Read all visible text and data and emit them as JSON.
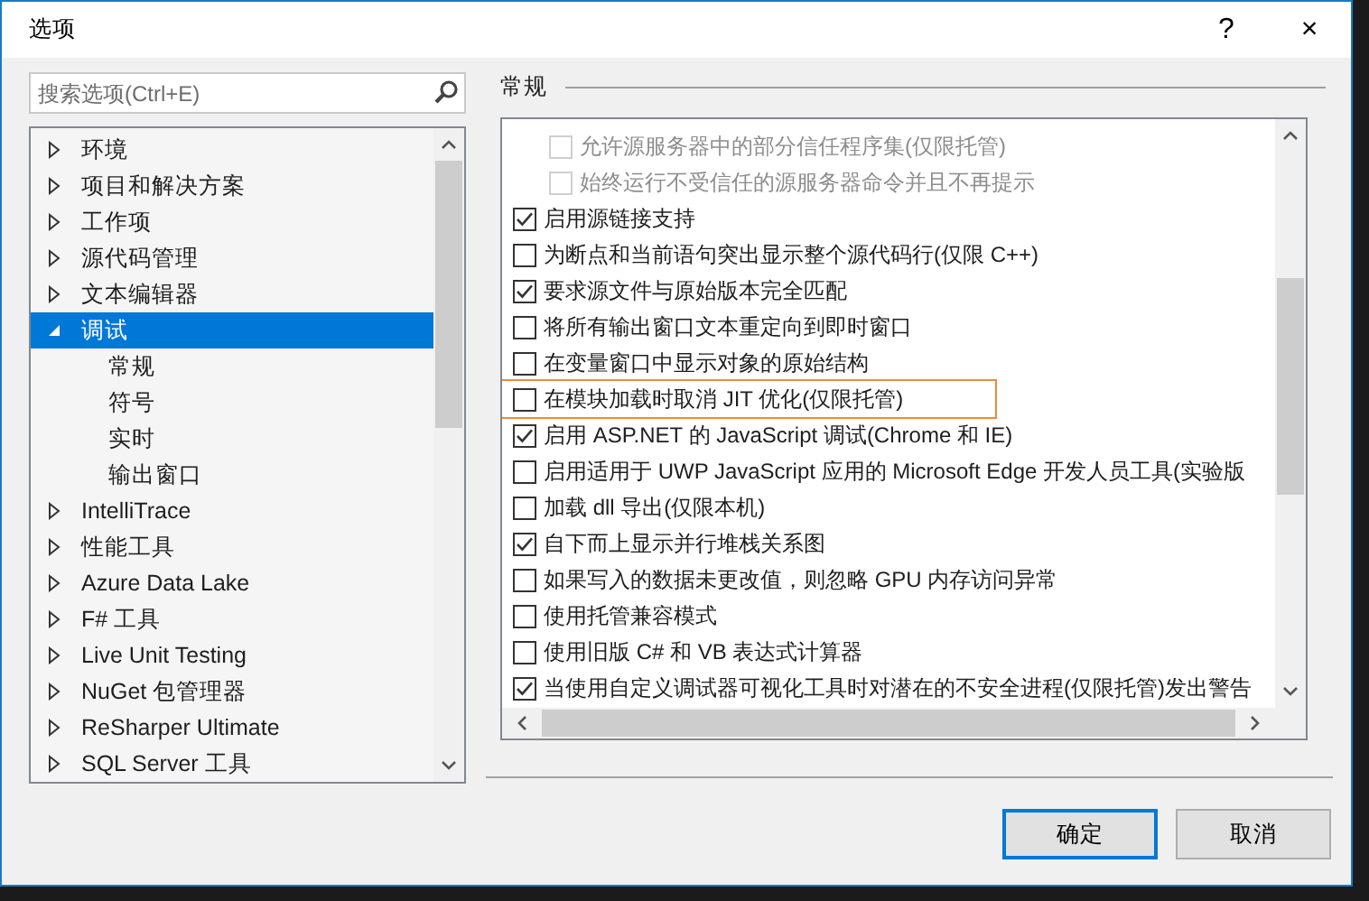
{
  "window": {
    "title": "选项",
    "help": "?",
    "close": "×"
  },
  "search": {
    "placeholder": "搜索选项(Ctrl+E)"
  },
  "tree": [
    {
      "label": "环境",
      "expanded": false,
      "selected": false
    },
    {
      "label": "项目和解决方案",
      "expanded": false,
      "selected": false
    },
    {
      "label": "工作项",
      "expanded": false,
      "selected": false
    },
    {
      "label": "源代码管理",
      "expanded": false,
      "selected": false
    },
    {
      "label": "文本编辑器",
      "expanded": false,
      "selected": false
    },
    {
      "label": "调试",
      "expanded": true,
      "selected": true,
      "children": [
        {
          "label": "常规",
          "selected": false
        },
        {
          "label": "符号",
          "selected": false
        },
        {
          "label": "实时",
          "selected": false
        },
        {
          "label": "输出窗口",
          "selected": false
        }
      ]
    },
    {
      "label": "IntelliTrace",
      "expanded": false,
      "selected": false
    },
    {
      "label": "性能工具",
      "expanded": false,
      "selected": false
    },
    {
      "label": "Azure Data Lake",
      "expanded": false,
      "selected": false
    },
    {
      "label": "F# 工具",
      "expanded": false,
      "selected": false
    },
    {
      "label": "Live Unit Testing",
      "expanded": false,
      "selected": false
    },
    {
      "label": "NuGet 包管理器",
      "expanded": false,
      "selected": false
    },
    {
      "label": "ReSharper Ultimate",
      "expanded": false,
      "selected": false
    },
    {
      "label": "SQL Server 工具",
      "expanded": false,
      "selected": false
    }
  ],
  "section_title": "常规",
  "options": [
    {
      "kind": "sub",
      "label": "允许源服务器中的部分信任程序集(仅限托管)",
      "checked": false,
      "disabled": true,
      "highlighted": false
    },
    {
      "kind": "sub",
      "label": "始终运行不受信任的源服务器命令并且不再提示",
      "checked": false,
      "disabled": true,
      "highlighted": false
    },
    {
      "kind": "main",
      "label": "启用源链接支持",
      "checked": true,
      "disabled": false,
      "highlighted": false
    },
    {
      "kind": "main",
      "label": "为断点和当前语句突出显示整个源代码行(仅限 C++)",
      "checked": false,
      "disabled": false,
      "highlighted": false
    },
    {
      "kind": "main",
      "label": "要求源文件与原始版本完全匹配",
      "checked": true,
      "disabled": false,
      "highlighted": false
    },
    {
      "kind": "main",
      "label": "将所有输出窗口文本重定向到即时窗口",
      "checked": false,
      "disabled": false,
      "highlighted": false
    },
    {
      "kind": "main",
      "label": "在变量窗口中显示对象的原始结构",
      "checked": false,
      "disabled": false,
      "highlighted": false
    },
    {
      "kind": "main",
      "label": "在模块加载时取消 JIT 优化(仅限托管)",
      "checked": false,
      "disabled": false,
      "highlighted": true
    },
    {
      "kind": "main",
      "label": "启用 ASP.NET 的 JavaScript 调试(Chrome 和 IE)",
      "checked": true,
      "disabled": false,
      "highlighted": false
    },
    {
      "kind": "main",
      "label": "启用适用于 UWP JavaScript 应用的 Microsoft Edge 开发人员工具(实验版",
      "checked": false,
      "disabled": false,
      "highlighted": false
    },
    {
      "kind": "main",
      "label": "加载 dll 导出(仅限本机)",
      "checked": false,
      "disabled": false,
      "highlighted": false
    },
    {
      "kind": "main",
      "label": "自下而上显示并行堆栈关系图",
      "checked": true,
      "disabled": false,
      "highlighted": false
    },
    {
      "kind": "main",
      "label": "如果写入的数据未更改值，则忽略 GPU 内存访问异常",
      "checked": false,
      "disabled": false,
      "highlighted": false
    },
    {
      "kind": "main",
      "label": "使用托管兼容模式",
      "checked": false,
      "disabled": false,
      "highlighted": false
    },
    {
      "kind": "main",
      "label": "使用旧版 C# 和 VB 表达式计算器",
      "checked": false,
      "disabled": false,
      "highlighted": false
    },
    {
      "kind": "main",
      "label": "当使用自定义调试器可视化工具时对潜在的不安全进程(仅限托管)发出警告",
      "checked": true,
      "disabled": false,
      "highlighted": false
    }
  ],
  "buttons": [
    {
      "label": "确定",
      "default": true
    },
    {
      "label": "取消",
      "default": false
    }
  ]
}
